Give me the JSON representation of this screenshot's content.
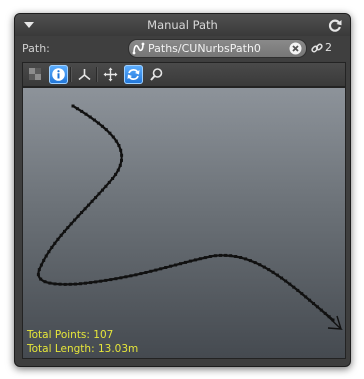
{
  "window": {
    "title": "Manual Path",
    "collapse_icon": "triangle-down-icon",
    "refresh_icon": "refresh-icon"
  },
  "path": {
    "label": "Path:",
    "value": "Paths/CUNurbsPath0",
    "field_icon": "nurbs-path-icon",
    "clear_icon": "clear-icon",
    "link_icon": "link-icon",
    "link_count": "2"
  },
  "toolbar": {
    "buttons": [
      {
        "icon": "checker-icon",
        "active": false
      },
      {
        "icon": "info-icon",
        "active": true
      },
      {
        "icon": "axis-icon",
        "active": false
      },
      {
        "icon": "move-icon",
        "active": false
      },
      {
        "icon": "sync-icon",
        "active": true
      },
      {
        "icon": "zoom-icon",
        "active": false
      }
    ]
  },
  "viewport": {
    "total_points": "Total Points: 107",
    "total_length": "Total Length: 13.03m",
    "stats_color": "#e6e63a",
    "curve_color": "#111111"
  }
}
